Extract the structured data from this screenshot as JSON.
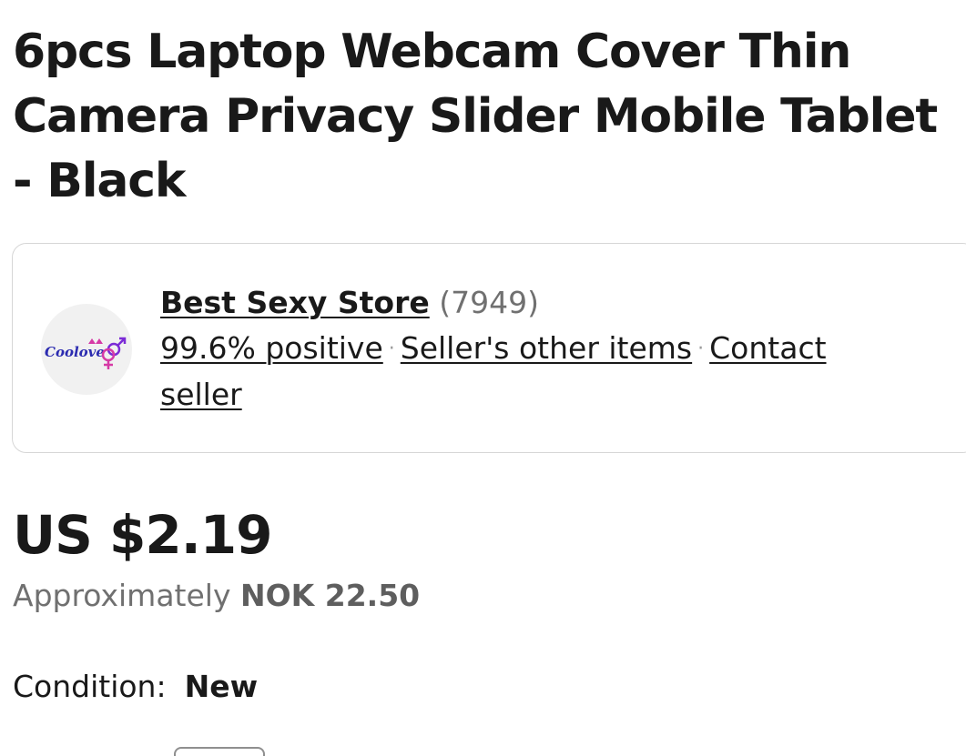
{
  "product": {
    "title": "6pcs Laptop Webcam Cover Thin Camera Privacy Slider Mobile Tablet - Black"
  },
  "seller": {
    "logo_text": "Coolove",
    "logo_icon": "gender-symbols-icon",
    "name": "Best Sexy Store",
    "feedback_count": "(7949)",
    "positive": "99.6% positive",
    "separator": "·",
    "other_items_label": "Seller's other items",
    "contact_label": "Contact seller"
  },
  "pricing": {
    "price": "US $2.19",
    "approx_label": "Approximately",
    "approx_value": "NOK 22.50"
  },
  "condition": {
    "label": "Condition:",
    "value": "New"
  },
  "colors": {
    "text": "#191919",
    "muted": "#707070",
    "border": "#d6d6d6",
    "logo_purple": "#7b2bd6",
    "logo_pink": "#d63aa6"
  }
}
